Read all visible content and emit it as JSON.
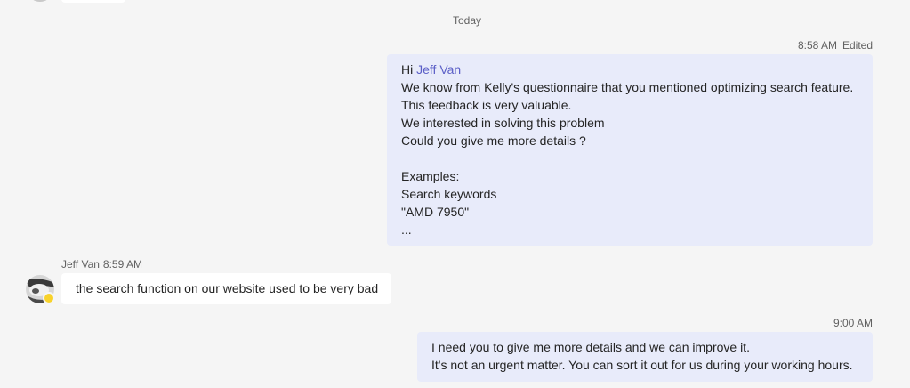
{
  "day_divider": "Today",
  "messages": [
    {
      "time": "8:58 AM",
      "edited": "Edited",
      "greeting": "Hi ",
      "mention": "Jeff Van",
      "lines": [
        "We know from Kelly's questionnaire that you mentioned optimizing search feature.",
        "This feedback is very valuable.",
        "We interested in solving this problem",
        "Could you give me more details ?",
        "",
        "Examples:",
        "Search keywords",
        "\"AMD 7950\"",
        "..."
      ]
    },
    {
      "sender": "Jeff Van",
      "time": "8:59 AM",
      "text": "the search function on our website used to be very bad",
      "presence": "away",
      "presence_color": "#f8d22a"
    },
    {
      "time": "9:00 AM",
      "lines": [
        "I need you to give me more details and we can improve it.",
        "It's not an urgent matter. You can sort it out for us during your working hours."
      ]
    }
  ],
  "colors": {
    "background": "#f5f5f5",
    "my_bubble": "#e8ebfa",
    "other_bubble": "#ffffff",
    "mention": "#5b5fc7",
    "meta_text": "#616161"
  }
}
